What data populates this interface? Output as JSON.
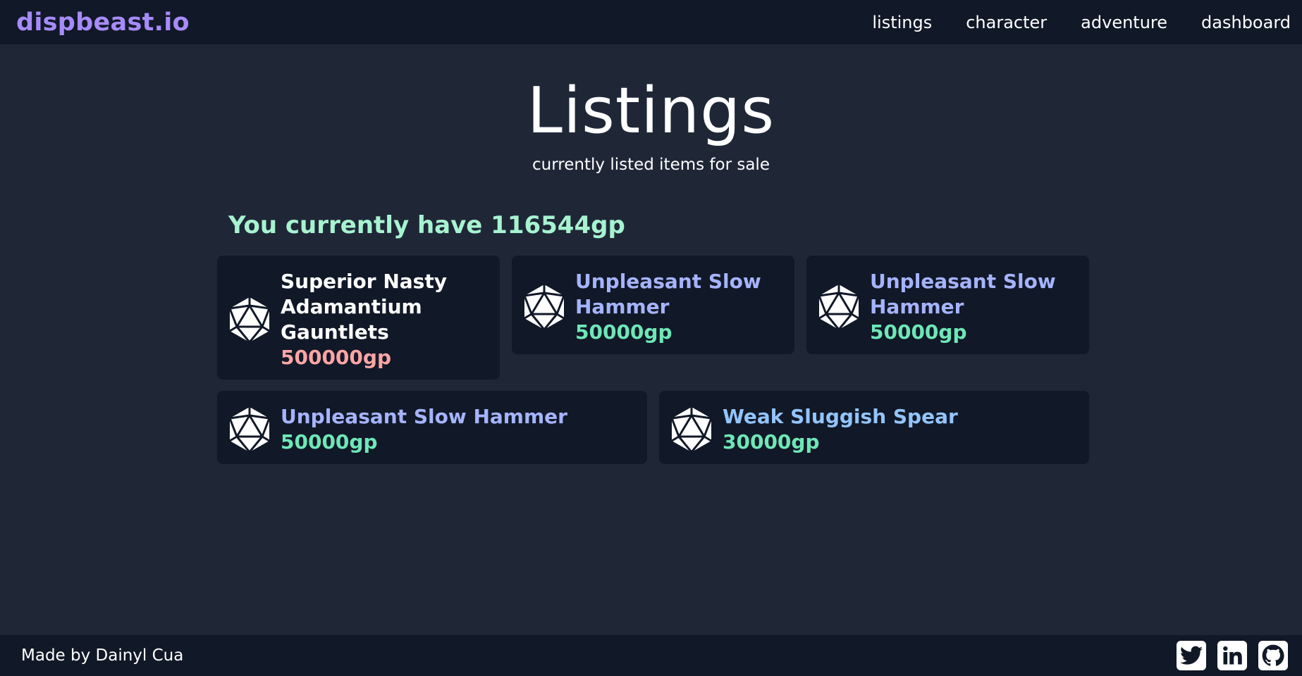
{
  "nav": {
    "brand": "dispbeast.io",
    "links": [
      "listings",
      "character",
      "adventure",
      "dashboard"
    ]
  },
  "hero": {
    "title": "Listings",
    "subtitle": "currently listed items for sale"
  },
  "balance_text": "You currently have 116544gp",
  "listings": [
    {
      "name": "Superior Nasty Adamantium Gauntlets",
      "price": "500000gp",
      "name_color": "#ffffff",
      "price_color": "#fca5a5"
    },
    {
      "name": "Unpleasant Slow Hammer",
      "price": "50000gp",
      "name_color": "#a5b4fc",
      "price_color": "#6ee7b7"
    },
    {
      "name": "Unpleasant Slow Hammer",
      "price": "50000gp",
      "name_color": "#a5b4fc",
      "price_color": "#6ee7b7"
    },
    {
      "name": "Unpleasant Slow Hammer",
      "price": "50000gp",
      "name_color": "#a5b4fc",
      "price_color": "#6ee7b7"
    },
    {
      "name": "Weak Sluggish Spear",
      "price": "30000gp",
      "name_color": "#93c5fd",
      "price_color": "#6ee7b7"
    }
  ],
  "icons": {
    "item": "d20-icon",
    "socials": [
      "twitter-icon",
      "linkedin-icon",
      "github-icon"
    ]
  },
  "footer": {
    "credit": "Made by Dainyl Cua"
  },
  "colors": {
    "background": "#1f2737",
    "panel": "#111827",
    "brand": "#a78bfa",
    "balance": "#a7f3d0"
  }
}
